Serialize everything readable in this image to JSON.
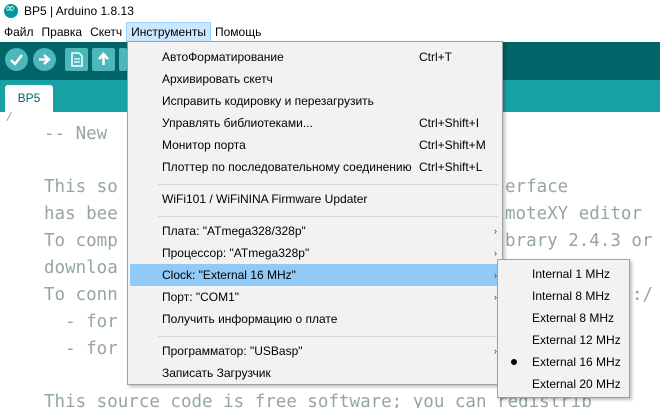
{
  "window": {
    "title": "BP5 | Arduino 1.8.13"
  },
  "menubar": {
    "items": [
      "Файл",
      "Правка",
      "Скетч",
      "Инструменты",
      "Помощь"
    ]
  },
  "tab": {
    "label": "BP5"
  },
  "editor": {
    "lines": [
      "-- New",
      "This so",
      "has bee",
      "To comp",
      "downloa",
      "To conn",
      "  - for",
      "  - for",
      "This source code is free software; you can redistrib"
    ],
    "right_fragments": [
      "erface",
      "moteXY editor",
      "brary 2.4.3 or",
      ":/"
    ]
  },
  "tools_menu": {
    "items": [
      {
        "label": "АвтоФорматирование",
        "shortcut": "Ctrl+T"
      },
      {
        "label": "Архивировать скетч",
        "shortcut": ""
      },
      {
        "label": "Исправить кодировку и перезагрузить",
        "shortcut": ""
      },
      {
        "label": "Управлять библиотеками...",
        "shortcut": "Ctrl+Shift+I"
      },
      {
        "label": "Монитор порта",
        "shortcut": "Ctrl+Shift+M"
      },
      {
        "label": "Плоттер по последовательному соединению",
        "shortcut": "Ctrl+Shift+L"
      },
      {
        "label": "WiFi101 / WiFiNINA Firmware Updater",
        "shortcut": ""
      },
      {
        "label": "Плата: \"ATmega328/328p\"",
        "shortcut": ""
      },
      {
        "label": "Процессор: \"ATmega328p\"",
        "shortcut": ""
      },
      {
        "label": "Clock: \"External 16 MHz\"",
        "shortcut": ""
      },
      {
        "label": "Порт: \"COM1\"",
        "shortcut": ""
      },
      {
        "label": "Получить информацию о плате",
        "shortcut": ""
      },
      {
        "label": "Программатор: \"USBasp\"",
        "shortcut": ""
      },
      {
        "label": "Записать Загрузчик",
        "shortcut": ""
      }
    ],
    "arrow_glyph": "›"
  },
  "clock_submenu": {
    "items": [
      "Internal 1 MHz",
      "Internal 8 MHz",
      "External 8 MHz",
      "External 12 MHz",
      "External 16 MHz",
      "External 20 MHz"
    ],
    "selected": "External 16 MHz"
  },
  "colors": {
    "toolbar": "#006468",
    "tabbar": "#17a1a5",
    "button": "#4db7bb",
    "menu_highlight": "#91c9f7",
    "code_comment": "#95a5a6"
  }
}
